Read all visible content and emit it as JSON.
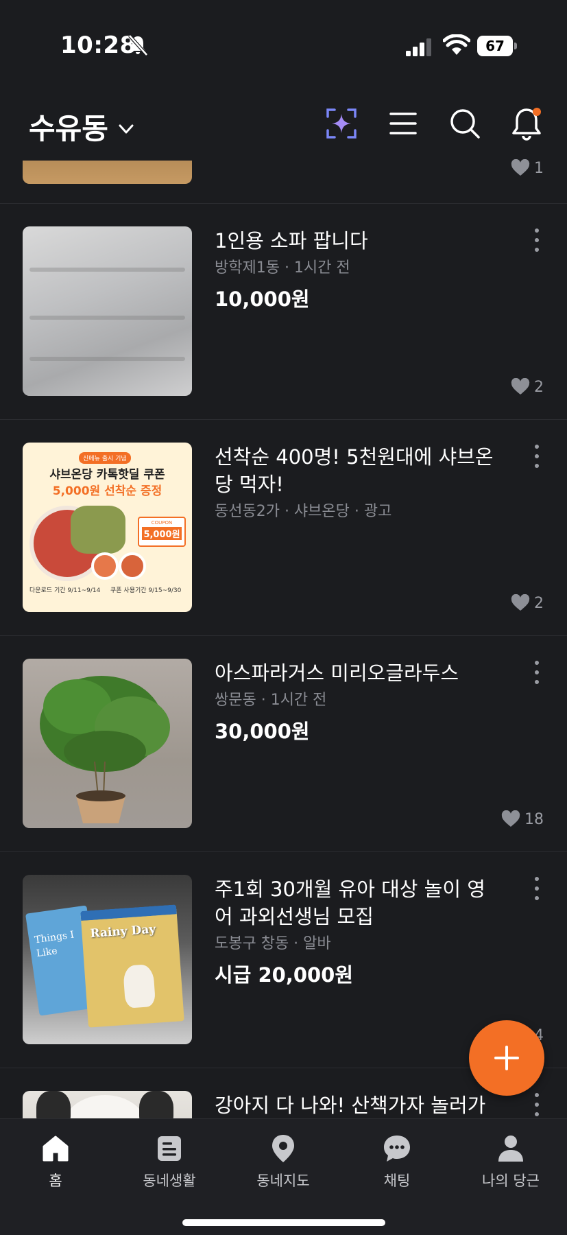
{
  "status_bar": {
    "time": "10:28",
    "battery": "67"
  },
  "header": {
    "location": "수유동",
    "icons": [
      "sparkle-ai-icon",
      "menu-icon",
      "search-icon",
      "notification-bell-icon"
    ],
    "notification_dot_color": "#f36f25"
  },
  "feed": {
    "partial_top": {
      "likes": "1"
    },
    "items": [
      {
        "title": "1인용 소파 팝니다",
        "meta": "방학제1동 · 1시간 전",
        "price": "10,000원",
        "likes": "2"
      },
      {
        "title": "선착순 400명! 5천원대에 샤브온당 먹자!",
        "meta": "동선동2가 · 샤브온당 · 광고",
        "price": "",
        "likes": "2",
        "ad": {
          "badge": "신메뉴 출시 기념",
          "headline": "샤브온당 카톡핫딜 쿠폰",
          "subheadline": "5,000원 선착순 증정",
          "coupon_label": "COUPON",
          "coupon_value": "5,000원",
          "download_period": "다운로드 기간 9/11~9/14",
          "use_period": "쿠폰 사용기간 9/15~9/30"
        }
      },
      {
        "title": "아스파라거스  미리오글라두스",
        "meta": "쌍문동 · 1시간 전",
        "price": "30,000원",
        "likes": "18"
      },
      {
        "title": "주1회 30개월 유아 대상 놀이 영어 과외선생님 모집",
        "meta": "도봉구 창동 · 알바",
        "price": "시급 20,000원",
        "likes": "4",
        "book_text_1": "Things I Like",
        "book_text_2": "Rainy Day"
      },
      {
        "title": "강아지 다 나와! 산책가자 놀러가자",
        "meta": "",
        "price": "",
        "likes": ""
      }
    ]
  },
  "fab": {
    "icon": "plus-icon",
    "color": "#f36f25"
  },
  "bottom_nav": {
    "items": [
      {
        "label": "홈",
        "icon": "home-icon",
        "active": true
      },
      {
        "label": "동네생활",
        "icon": "document-icon",
        "active": false
      },
      {
        "label": "동네지도",
        "icon": "map-pin-icon",
        "active": false
      },
      {
        "label": "채팅",
        "icon": "chat-bubble-icon",
        "active": false
      },
      {
        "label": "나의 당근",
        "icon": "profile-icon",
        "active": false
      }
    ]
  }
}
